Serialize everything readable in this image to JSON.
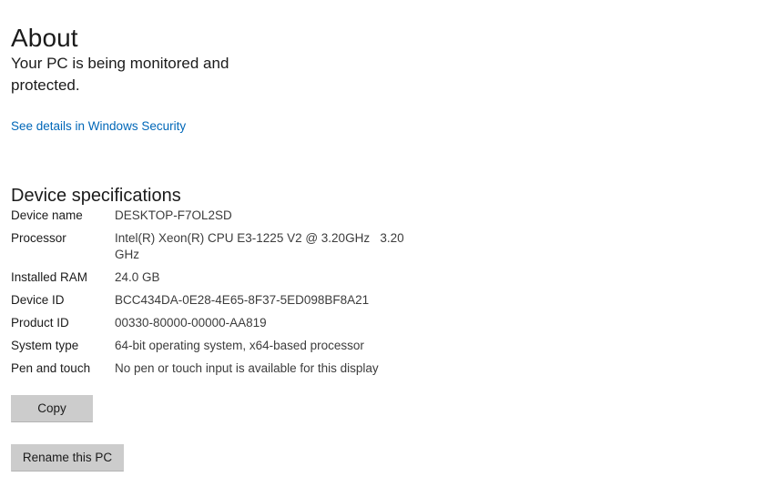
{
  "page": {
    "title": "About",
    "status_text": "Your PC is being monitored and protected.",
    "security_link": "See details in Windows Security",
    "section_title": "Device specifications",
    "link_color": "#0067b8",
    "button_color": "#cccccc"
  },
  "specs": [
    {
      "label": "Device name",
      "value": "DESKTOP-F7OL2SD"
    },
    {
      "label": "Processor",
      "value": "Intel(R) Xeon(R) CPU E3-1225 V2 @ 3.20GHz   3.20 GHz"
    },
    {
      "label": "Installed RAM",
      "value": "24.0 GB"
    },
    {
      "label": "Device ID",
      "value": "BCC434DA-0E28-4E65-8F37-5ED098BF8A21"
    },
    {
      "label": "Product ID",
      "value": "00330-80000-00000-AA819"
    },
    {
      "label": "System type",
      "value": "64-bit operating system, x64-based processor"
    },
    {
      "label": "Pen and touch",
      "value": "No pen or touch input is available for this display"
    }
  ],
  "buttons": {
    "copy": "Copy",
    "rename": "Rename this PC"
  }
}
